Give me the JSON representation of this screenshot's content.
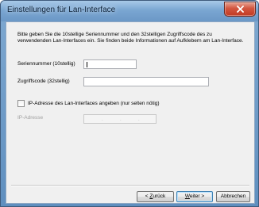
{
  "window": {
    "title": "Einstellungen für Lan-Interface"
  },
  "dialog": {
    "description": "Bitte geben Sie die 10stellige Seriennummer und den 32stelligen Zugriffscode des zu verwendenden Lan-Interfaces ein. Sie finden beide Informationen auf Aufklebern am Lan-Interface.",
    "serial_label": "Seriennummer (10stellig)",
    "serial_value": "",
    "access_code_label": "Zugriffscode (32stellig)",
    "access_code_value": "",
    "ip_checkbox_label": "IP-Adresse des Lan-Interfaces angeben (nur selten nötig)",
    "ip_checkbox_checked": false,
    "ip_label": "IP-Adresse",
    "ip_value": ""
  },
  "buttons": {
    "back_prefix": "< ",
    "back_hotkey": "Z",
    "back_rest": "urück",
    "next_hotkey": "W",
    "next_rest": "eiter >",
    "cancel_label": "Abbrechen"
  }
}
